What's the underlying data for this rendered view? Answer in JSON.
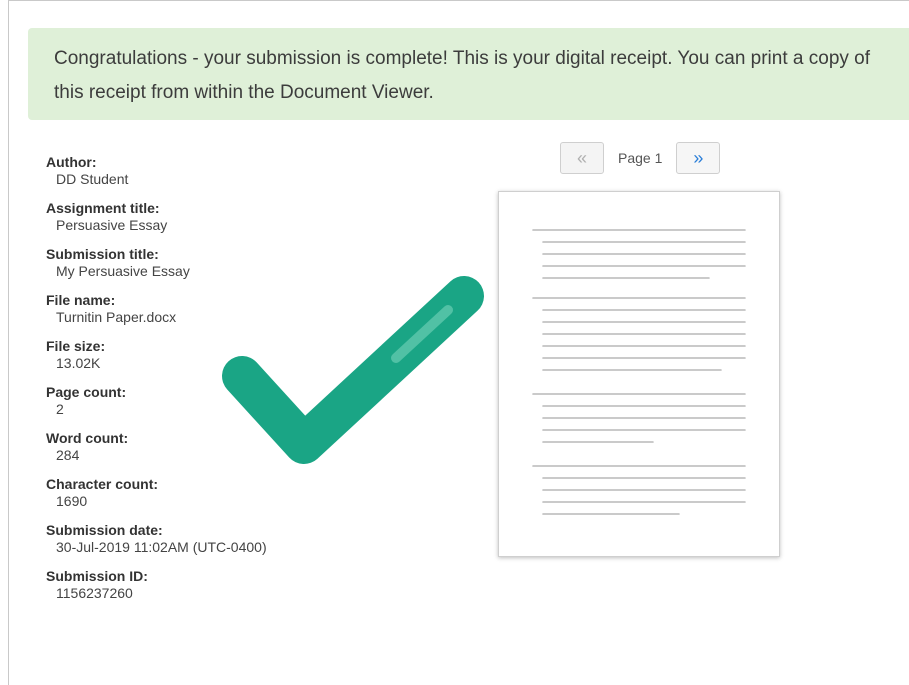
{
  "banner": {
    "message": "Congratulations - your submission is complete! This is your digital receipt. You can print a copy of this receipt from within the Document Viewer."
  },
  "receipt": [
    {
      "label": "Author:",
      "value": "DD Student"
    },
    {
      "label": "Assignment title:",
      "value": "Persuasive Essay"
    },
    {
      "label": "Submission title:",
      "value": "My Persuasive Essay"
    },
    {
      "label": "File name:",
      "value": "Turnitin Paper.docx"
    },
    {
      "label": "File size:",
      "value": "13.02K"
    },
    {
      "label": "Page count:",
      "value": "2"
    },
    {
      "label": "Word count:",
      "value": "284"
    },
    {
      "label": "Character count:",
      "value": "1690"
    },
    {
      "label": "Submission date:",
      "value": "30-Jul-2019 11:02AM (UTC-0400)"
    },
    {
      "label": "Submission ID:",
      "value": "1156237260"
    }
  ],
  "viewer": {
    "prev_glyph": "«",
    "page_label": "Page 1",
    "next_glyph": "»"
  },
  "colors": {
    "banner_bg": "#dff0d8",
    "check": "#1aa585",
    "next_accent": "#2a7ed8"
  },
  "icons": {
    "check": "checkmark-icon",
    "prev": "double-chevron-left-icon",
    "next": "double-chevron-right-icon"
  }
}
